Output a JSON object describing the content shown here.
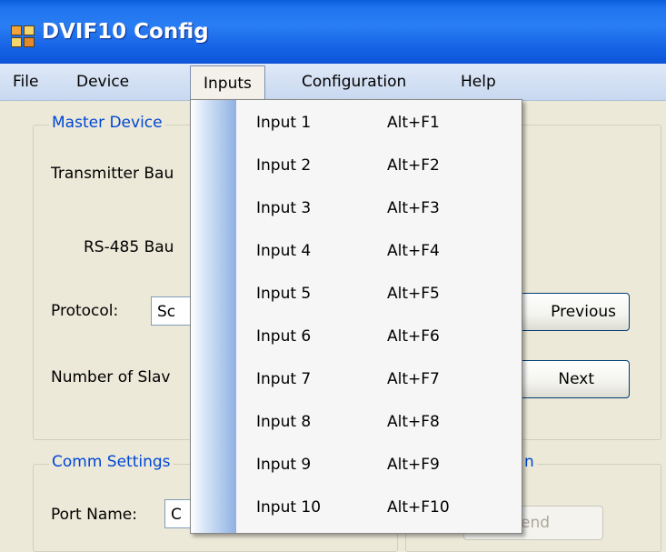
{
  "window": {
    "title": "DVIF10 Config"
  },
  "menubar": {
    "items": [
      {
        "label": "File"
      },
      {
        "label": "Device"
      },
      {
        "label": "Inputs"
      },
      {
        "label": "Configuration"
      },
      {
        "label": "Help"
      }
    ]
  },
  "inputs_menu": {
    "items": [
      {
        "label": "Input 1",
        "shortcut": "Alt+F1"
      },
      {
        "label": "Input 2",
        "shortcut": "Alt+F2"
      },
      {
        "label": "Input 3",
        "shortcut": "Alt+F3"
      },
      {
        "label": "Input 4",
        "shortcut": "Alt+F4"
      },
      {
        "label": "Input 5",
        "shortcut": "Alt+F5"
      },
      {
        "label": "Input 6",
        "shortcut": "Alt+F6"
      },
      {
        "label": "Input 7",
        "shortcut": "Alt+F7"
      },
      {
        "label": "Input 8",
        "shortcut": "Alt+F8"
      },
      {
        "label": "Input 9",
        "shortcut": "Alt+F9"
      },
      {
        "label": "Input 10",
        "shortcut": "Alt+F10"
      }
    ]
  },
  "master_device": {
    "legend": "Master Device",
    "transmitter_baud_label": "Transmitter Bau",
    "rs485_baud_label": "RS-485 Bau",
    "protocol_label": "Protocol:",
    "protocol_value": "Sc",
    "num_slaves_label": "Number of Slav",
    "previous_button": "Previous",
    "next_button": "Next"
  },
  "comm_settings": {
    "legend": "Comm Settings",
    "port_name_label": "Port Name:",
    "port_name_value": "C",
    "right_legend_fragment": "n",
    "send_button": "end"
  }
}
